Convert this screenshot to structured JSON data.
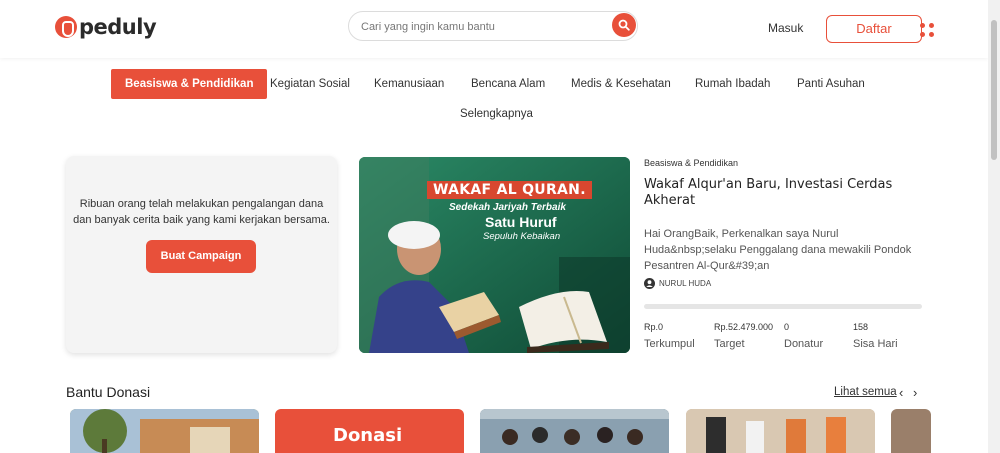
{
  "header": {
    "logo_text": "peduly",
    "search_placeholder": "Cari yang ingin kamu bantu",
    "login_label": "Masuk",
    "register_label": "Daftar",
    "accent_color": "#e8503a"
  },
  "categories": [
    {
      "label": "Beasiswa & Pendidikan",
      "active": true
    },
    {
      "label": "Kegiatan Sosial",
      "active": false
    },
    {
      "label": "Kemanusiaan",
      "active": false
    },
    {
      "label": "Bencana Alam",
      "active": false
    },
    {
      "label": "Medis & Kesehatan",
      "active": false
    },
    {
      "label": "Rumah Ibadah",
      "active": false
    },
    {
      "label": "Panti Asuhan",
      "active": false
    },
    {
      "label": "Selengkapnya",
      "active": false
    }
  ],
  "promo": {
    "text": "Ribuan orang telah melakukan pengalangan dana dan banyak cerita baik yang kami kerjakan bersama.",
    "button_label": "Buat Campaign"
  },
  "featured": {
    "image_text": {
      "title": "WAKAF AL QURAN.",
      "line1": "Sedekah Jariyah Terbaik",
      "line2": "Satu Huruf",
      "line3": "Sepuluh Kebaikan"
    },
    "category": "Beasiswa & Pendidikan",
    "title": "Wakaf Alqur'an Baru, Investasi Cerdas Akherat",
    "description": "Hai OrangBaik, Perkenalkan saya Nurul Huda&nbsp;selaku Penggalang dana mewakili Pondok Pesantren Al-Qur&#39;an",
    "organizer": "NURUL HUDA",
    "progress_fraction": 0,
    "stats": {
      "collected_value": "Rp.0",
      "collected_label": "Terkumpul",
      "target_value": "Rp.52.479.000",
      "target_label": "Target",
      "donors_value": "0",
      "donors_label": "Donatur",
      "days_value": "158",
      "days_label": "Sisa Hari"
    }
  },
  "donations_section": {
    "title": "Bantu Donasi",
    "see_all_label": "Lihat semua",
    "prev_arrow": "‹",
    "next_arrow": "›",
    "card2_text": "Donasi"
  }
}
